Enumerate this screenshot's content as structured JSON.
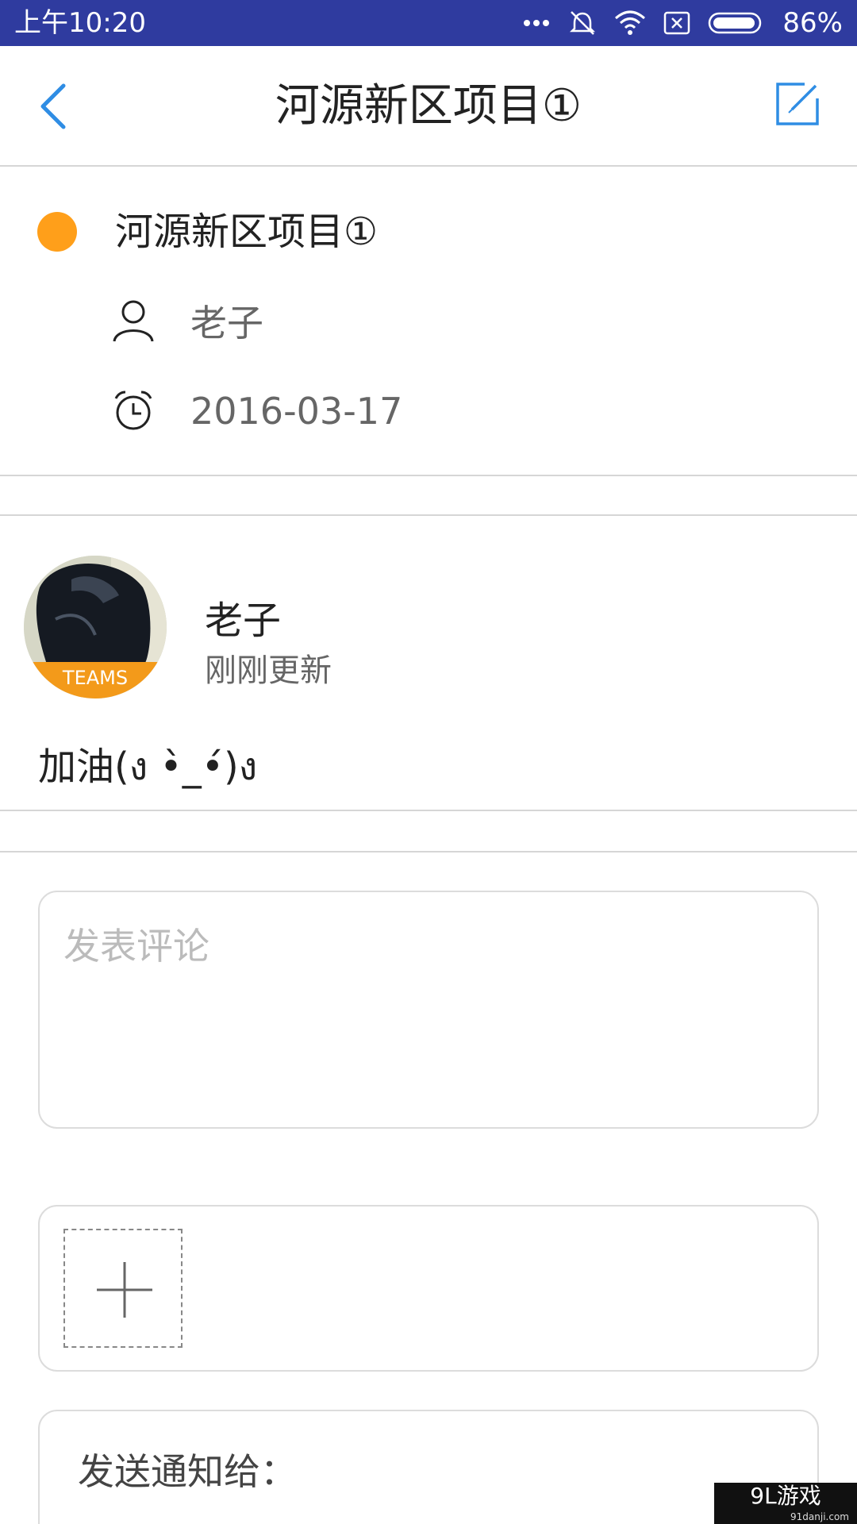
{
  "status_bar": {
    "time": "上午10:20",
    "battery": "86%",
    "icons": [
      "more-dots-icon",
      "alarm-off-icon",
      "wifi-icon",
      "sim-x-icon",
      "battery-icon"
    ],
    "bg_color": "#2f3b9f"
  },
  "header": {
    "title": "河源新区项目①",
    "back_icon": "back-chevron-icon",
    "edit_icon": "edit-icon",
    "accent": "#2f8de4"
  },
  "project": {
    "name": "河源新区项目①",
    "status_color": "#ff9f1a",
    "owner": "老子",
    "date": "2016-03-17"
  },
  "post": {
    "author": "老子",
    "time": "刚刚更新",
    "avatar_band_text": "TEAMS",
    "content": "加油(ง •̀_•́)ง"
  },
  "comment": {
    "placeholder": "发表评论"
  },
  "attachments": {
    "add_icon": "plus-icon"
  },
  "notify": {
    "label": "发送通知给："
  },
  "watermark": {
    "text": "9L游戏",
    "sub": "91danji.com"
  }
}
